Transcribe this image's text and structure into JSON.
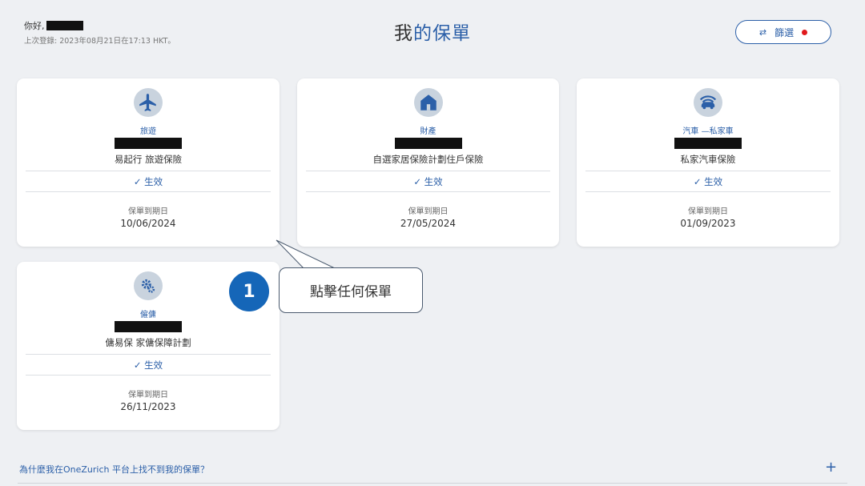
{
  "header": {
    "greeting": "你好,",
    "last_login": "上次登錄: 2023年08月21日在17:13 HKT。",
    "title_part1": "我",
    "title_part2": "的保單",
    "filter_label": "篩選"
  },
  "policies": [
    {
      "icon": "airplane-icon",
      "category": "旅遊",
      "name": "易起行 旅遊保險",
      "status": "✓ 生效",
      "expiry_label": "保單到期日",
      "expiry_date": "10/06/2024"
    },
    {
      "icon": "house-icon",
      "category": "財產",
      "name": "自選家居保險計劃住戶保險",
      "status": "✓ 生效",
      "expiry_label": "保單到期日",
      "expiry_date": "27/05/2024"
    },
    {
      "icon": "car-icon",
      "category": "汽車 —私家車",
      "name": "私家汽車保險",
      "status": "✓ 生效",
      "expiry_label": "保單到期日",
      "expiry_date": "01/09/2023"
    },
    {
      "icon": "gears-icon",
      "category": "僱傭",
      "name": "傭易保 家傭保障計劃",
      "status": "✓ 生效",
      "expiry_label": "保單到期日",
      "expiry_date": "26/11/2023"
    }
  ],
  "callout": {
    "step": "1",
    "text": "點擊任何保單"
  },
  "faq": {
    "question": "為什麼我在OneZurich 平台上找不到我的保單？",
    "toggle": "+"
  },
  "colors": {
    "accent": "#2b5fa8",
    "badge": "#1566b8",
    "notification_dot": "#e0191c",
    "background": "#eef0f3"
  }
}
